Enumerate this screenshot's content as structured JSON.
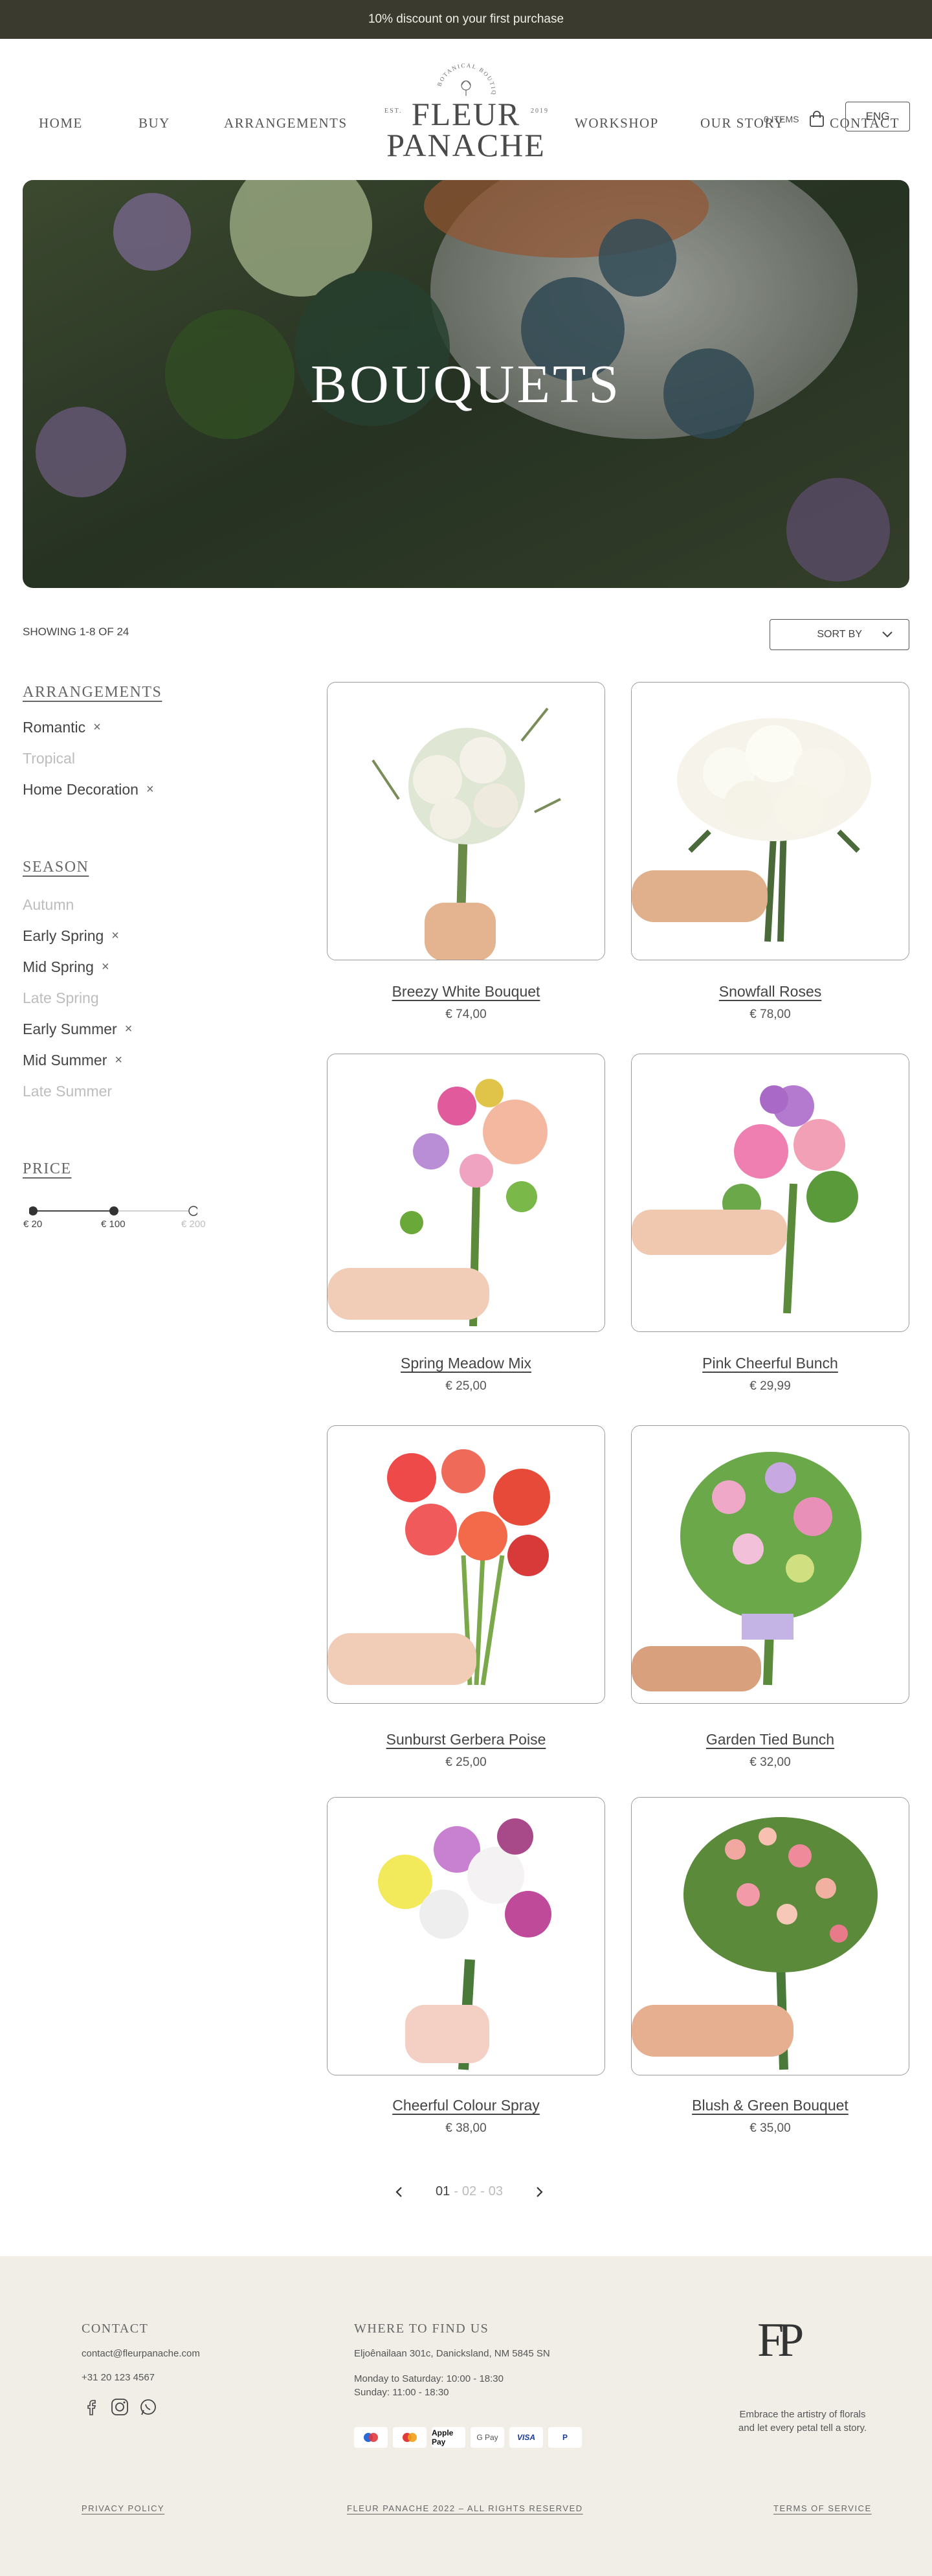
{
  "promo": "10% discount on your first purchase",
  "nav": {
    "home": "HOME",
    "buy": "BUY",
    "arrangements": "ARRANGEMENTS",
    "workshop": "WORKSHOP",
    "our_story": "OUR STORY",
    "contact": "CONTACT"
  },
  "logo": {
    "line1": "FLEUR",
    "line2": "PANACHE",
    "arc_text": "BOTANICAL BOUTIQUE",
    "est": "EST.",
    "year": "2019"
  },
  "cart": {
    "label": "0 ITEMS",
    "icon": "shopping-bag-icon"
  },
  "language": "ENG",
  "hero": {
    "title": "BOUQUETS"
  },
  "listing": {
    "showing": "SHOWING 1-8 OF 24",
    "sort_label": "SORT BY"
  },
  "filters": {
    "arrangements": {
      "title": "ARRANGEMENTS",
      "items": [
        {
          "label": "Romantic",
          "active": true
        },
        {
          "label": "Tropical",
          "active": false
        },
        {
          "label": "Home Decoration",
          "active": true
        }
      ]
    },
    "season": {
      "title": "SEASON",
      "items": [
        {
          "label": "Autumn",
          "active": false
        },
        {
          "label": "Early Spring",
          "active": true
        },
        {
          "label": "Mid Spring",
          "active": true
        },
        {
          "label": "Late Spring",
          "active": false
        },
        {
          "label": "Early Summer",
          "active": true
        },
        {
          "label": "Mid Summer",
          "active": true
        },
        {
          "label": "Late Summer",
          "active": false
        }
      ]
    },
    "price": {
      "title": "PRICE",
      "labels": [
        "€ 20",
        "€ 100",
        "€ 200"
      ],
      "range_selected": [
        20,
        100
      ],
      "range_max": 200
    }
  },
  "products": [
    {
      "name": "Breezy White Bouquet",
      "price": "€ 74,00"
    },
    {
      "name": "Snowfall Roses",
      "price": "€ 78,00"
    },
    {
      "name": "Spring Meadow Mix",
      "price": "€ 25,00"
    },
    {
      "name": "Pink Cheerful Bunch",
      "price": "€ 29,99"
    },
    {
      "name": "Sunburst Gerbera Poise",
      "price": "€ 25,00"
    },
    {
      "name": "Garden Tied Bunch",
      "price": "€ 32,00"
    },
    {
      "name": "Cheerful Colour Spray",
      "price": "€ 38,00"
    },
    {
      "name": "Blush & Green Bouquet",
      "price": "€ 35,00"
    }
  ],
  "pagination": {
    "current": "01",
    "p2": "02",
    "p3": "03",
    "sep": "-"
  },
  "footer": {
    "contact": {
      "title": "CONTACT",
      "email": "contact@fleurpanache.com",
      "phone": "+31 20 123 4567"
    },
    "find": {
      "title": "WHERE TO FIND US",
      "address": "Eljoênailaan 301c, Danicksland, NM 5845 SN",
      "hours1": "Monday to Saturday: 10:00 - 18:30",
      "hours2": "Sunday: 11:00 - 18:30"
    },
    "payments": [
      "Maestro",
      "Mastercard",
      "Apple Pay",
      "G Pay",
      "VISA",
      "PayPal"
    ],
    "monogram": "FP",
    "tagline1": "Embrace the artistry of florals",
    "tagline2": "and let every petal tell a story.",
    "privacy": "PRIVACY POLICY",
    "copyright": "FLEUR PANACHE 2022 – ALL RIGHTS RESERVED",
    "terms": "TERMS OF SERVICE"
  }
}
